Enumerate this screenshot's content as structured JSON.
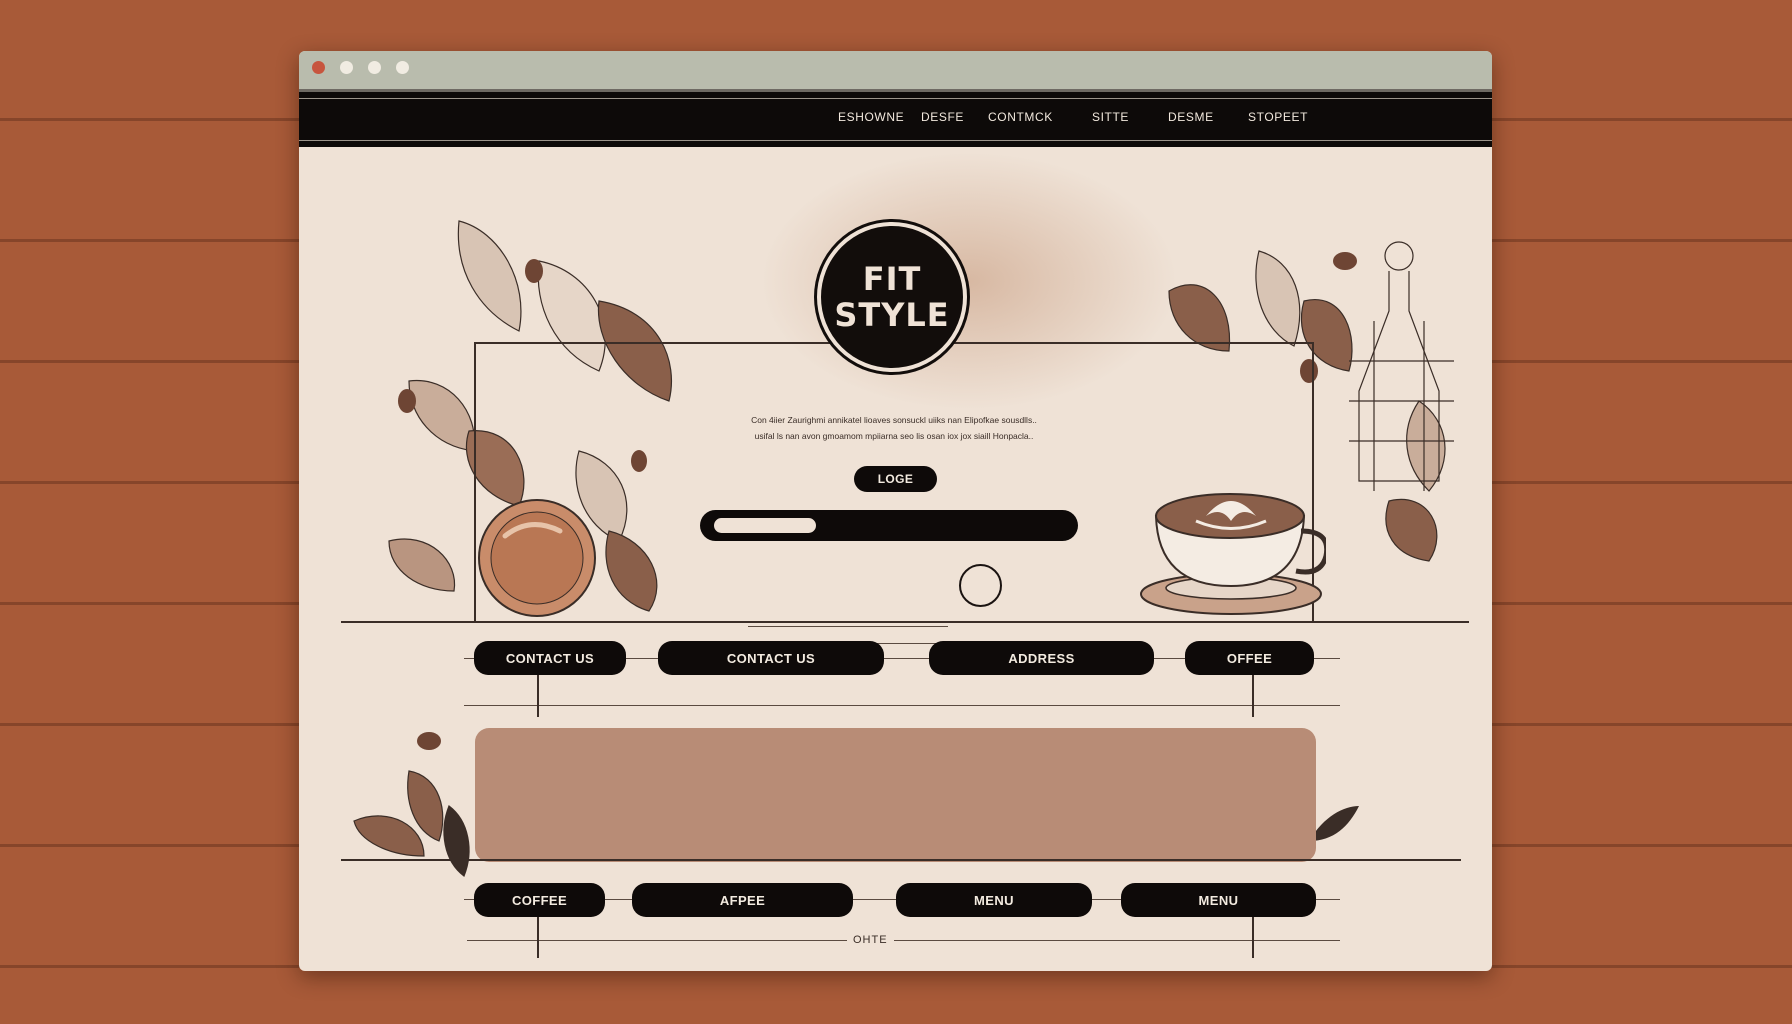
{
  "window": {
    "controls": [
      "close",
      "minimize",
      "zoom",
      "fullscreen"
    ]
  },
  "nav": {
    "items": [
      "ESHOWNE",
      "DESFE",
      "CONTMCK",
      "SITTE",
      "DESME",
      "STOPEET"
    ]
  },
  "hero": {
    "logo_line1": "FIT",
    "logo_line2": "STYLE",
    "intro_line1": "Con 4iier Zaurighmi annikatel lioaves sonsuckl uiiks nan Elipofkae sousdlls..",
    "intro_line2": "usifal ls nan avon gmoamom mpiiarna seo lis osan iox jox siaill Honpacla..",
    "login_label": "LOGE"
  },
  "row1": {
    "buttons": [
      "CONTACT US",
      "CONTACT US",
      "ADDRESS",
      "OFFEE"
    ]
  },
  "row2": {
    "buttons": [
      "COFFEE",
      "AFPEE",
      "MENU",
      "MENU"
    ]
  },
  "footer": {
    "note": "OHTE"
  },
  "colors": {
    "background_wood": "#a85a38",
    "page": "#efe2d6",
    "navbar": "#0d0a09",
    "pill": "#0e0a09",
    "panel": "#b88c76"
  },
  "icons": [
    "logo-badge",
    "coffee-cup-icon",
    "coffee-bean-icon",
    "leaf-icon",
    "circle-ring-icon"
  ]
}
